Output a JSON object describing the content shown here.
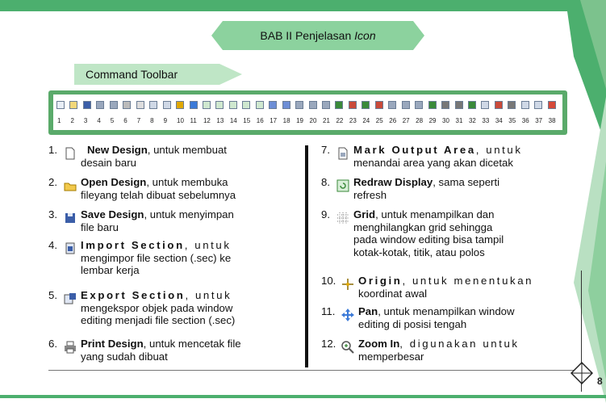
{
  "header": {
    "title_main": "BAB II Penjelasan ",
    "title_em": "Icon"
  },
  "section": {
    "label": "Command Toolbar"
  },
  "toolbar_numbers": [
    "1",
    "2",
    "3",
    "4",
    "5",
    "6",
    "7",
    "8",
    "9",
    "10",
    "11",
    "12",
    "13",
    "14",
    "15",
    "16",
    "17",
    "18",
    "19",
    "20",
    "21",
    "22",
    "23",
    "24",
    "25",
    "26",
    "27",
    "28",
    "29",
    "30",
    "31",
    "32",
    "33",
    "34",
    "35",
    "36",
    "37",
    "38"
  ],
  "items_left": [
    {
      "num": "1.",
      "name": "New Design",
      "desc_l1": ", untuk membuat",
      "desc_l2": "desain baru",
      "icon": "new-design-icon"
    },
    {
      "num": "2.",
      "name": "Open Design",
      "desc_l1": ", untuk membuka",
      "desc_l2": "fileyang telah dibuat sebelumnya",
      "icon": "open-design-icon"
    },
    {
      "num": "3.",
      "name": "Save Design",
      "desc_l1": ", untuk menyimpan",
      "desc_l2": "file baru",
      "icon": "save-design-icon"
    },
    {
      "num": "4.",
      "name": "Import Section",
      "desc_l1": ", untuk",
      "desc_l2": "mengimpor file section (.sec) ke",
      "desc_l3": "lembar kerja",
      "icon": "import-section-icon"
    },
    {
      "num": "5.",
      "name": "Export Section",
      "desc_l1": ", untuk",
      "desc_l2": "mengekspor objek pada window",
      "desc_l3": "editing menjadi file section (.sec)",
      "icon": "export-section-icon"
    },
    {
      "num": "6.",
      "name": "Print Design",
      "desc_l1": ", untuk mencetak file",
      "desc_l2": "yang sudah dibuat",
      "icon": "print-design-icon"
    }
  ],
  "items_right": [
    {
      "num": "7.",
      "name": "Mark Output Area",
      "desc_l1": ", untuk",
      "desc_l2": "menandai area yang akan dicetak",
      "icon": "mark-output-area-icon"
    },
    {
      "num": "8.",
      "name": "Redraw Display",
      "desc_l1": ", sama seperti",
      "desc_l2": "refresh",
      "icon": "redraw-display-icon"
    },
    {
      "num": "9.",
      "name": "Grid",
      "desc_l1": ", untuk menampilkan dan",
      "desc_l2": "menghilangkan grid sehingga",
      "desc_l3": "pada window editing bisa tampil",
      "desc_l4": "kotak-kotak, titik, atau polos",
      "icon": "grid-icon"
    },
    {
      "num": "10.",
      "name": "Origin",
      "desc_l1": ", untuk menentukan",
      "desc_l2": "koordinat awal",
      "icon": "origin-icon"
    },
    {
      "num": "11.",
      "name": "Pan",
      "desc_l1": ", untuk menampilkan window",
      "desc_l2": "editing di posisi tengah",
      "icon": "pan-icon"
    },
    {
      "num": "12.",
      "name": "Zoom In",
      "desc_l1": ", digunakan untuk",
      "desc_l2": "memperbesar",
      "icon": "zoom-in-icon"
    }
  ],
  "footer": {
    "page_number": "8"
  },
  "colors": {
    "accent_green": "#4caf6e",
    "banner_green": "#8cd29e",
    "tag_green": "#bfe6c6"
  }
}
